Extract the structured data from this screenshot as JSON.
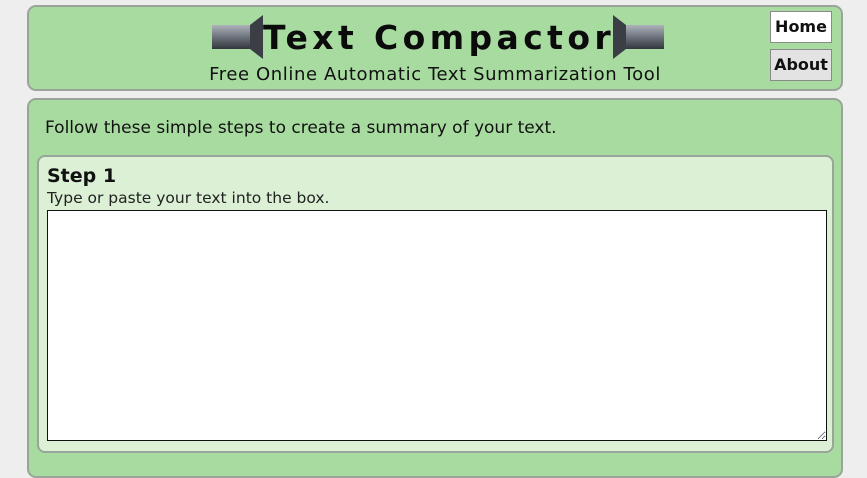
{
  "header": {
    "title": "Text Compactor",
    "subtitle": "Free Online Automatic Text Summarization Tool",
    "nav": {
      "home_label": "Home",
      "about_label": "About"
    }
  },
  "main": {
    "intro": "Follow these simple steps to create a summary of your text.",
    "step1": {
      "title": "Step 1",
      "description": "Type or paste your text into the box.",
      "text_value": ""
    }
  },
  "colors": {
    "panel_green": "#a8dba0",
    "step_green": "#dbf0d4",
    "page_bg": "#eeeeee"
  }
}
